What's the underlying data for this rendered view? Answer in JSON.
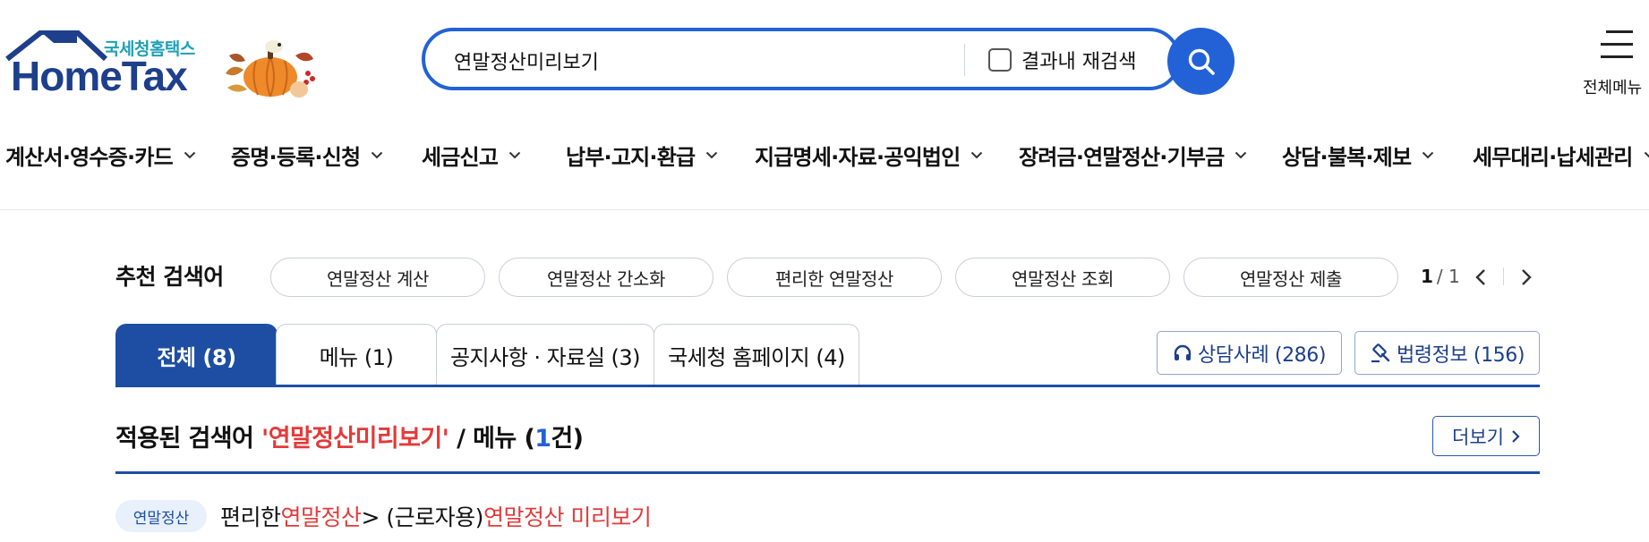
{
  "header": {
    "logo_sub": "국세청홈택스",
    "logo_main": "HomeTax",
    "search_value": "연말정산미리보기",
    "recheck_label": "결과내 재검색",
    "allmenu_label": "전체메뉴"
  },
  "nav": {
    "items": [
      "계산서·영수증·카드",
      "증명·등록·신청",
      "세금신고",
      "납부·고지·환급",
      "지급명세·자료·공익법인",
      "장려금·연말정산·기부금",
      "상담·불복·제보",
      "세무대리·납세관리"
    ]
  },
  "recommended": {
    "title": "추천 검색어",
    "chips": [
      "연말정산 계산",
      "연말정산 간소화",
      "편리한 연말정산",
      "연말정산 조회",
      "연말정산 제출"
    ],
    "page_current": "1",
    "page_total": "/ 1"
  },
  "tabs": [
    "전체 (8)",
    "메뉴 (1)",
    "공지사항 · 자료실 (3)",
    "국세청 홈페이지 (4)"
  ],
  "side_buttons": {
    "consult": "상담사례 (286)",
    "law": "법령정보 (156)"
  },
  "applied": {
    "prefix": "적용된 검색어 ",
    "keyword": "'연말정산미리보기'",
    "mid": " / 메뉴 (",
    "count": "1",
    "suffix": "건)",
    "more_label": "더보기"
  },
  "result": {
    "badge": "연말정산",
    "part1": "편리한 ",
    "part2": "연말정산",
    "part3": " > (근로자용) ",
    "part4": "연말정산 미리보기"
  },
  "colors": {
    "primary": "#1d4ea3",
    "search_blue": "#2362d6",
    "highlight_red": "#e33a3a",
    "logo_teal": "#1f9fb8"
  },
  "icons": {
    "search": "search-icon",
    "menu": "hamburger-icon",
    "chevron": "chevron-down-icon",
    "headset": "headset-icon",
    "gavel": "gavel-icon",
    "deco": "pumpkin-icon"
  }
}
